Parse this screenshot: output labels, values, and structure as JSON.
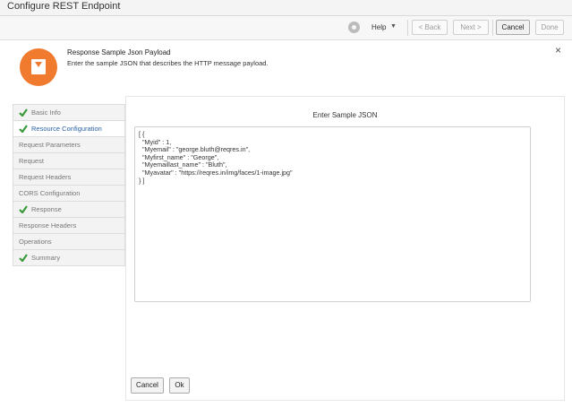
{
  "window": {
    "title": "Configure REST Endpoint"
  },
  "toolbar": {
    "help_label": "Help",
    "help_caret": "▼",
    "back_label": "< Back",
    "next_label": "Next >",
    "cancel_label": "Cancel",
    "done_label": "Done"
  },
  "banner": {
    "title": "Response Sample Json Payload",
    "subtitle": "Enter the sample JSON that describes the HTTP message payload.",
    "close": "×",
    "accent": "#f07b2f"
  },
  "sidebar": {
    "items": [
      {
        "label": "Basic Info",
        "checked": true,
        "current": false
      },
      {
        "label": "Resource Configuration",
        "checked": true,
        "current": true
      },
      {
        "label": "Request Parameters",
        "checked": false,
        "current": false
      },
      {
        "label": "Request",
        "checked": false,
        "current": false
      },
      {
        "label": "Request Headers",
        "checked": false,
        "current": false
      },
      {
        "label": "CORS Configuration",
        "checked": false,
        "current": false
      },
      {
        "label": "Response",
        "checked": true,
        "current": false
      },
      {
        "label": "Response Headers",
        "checked": false,
        "current": false
      },
      {
        "label": "Operations",
        "checked": false,
        "current": false
      },
      {
        "label": "Summary",
        "checked": true,
        "current": false
      }
    ],
    "check_color": "#3c9a3c",
    "current_color": "#2a62a8"
  },
  "main": {
    "title": "Enter Sample JSON",
    "json_text": "[ {\n  \"Myid\" : 1,\n  \"Myemail\" : \"george.bluth@reqres.in\",\n  \"Myfirst_name\" : \"George\",\n  \"Myemaillast_name\" : \"Bluth\",\n  \"Myavatar\" : \"https://reqres.in/img/faces/1-image.jpg\"\n} ]",
    "cancel_label": "Cancel",
    "ok_label": "Ok"
  }
}
